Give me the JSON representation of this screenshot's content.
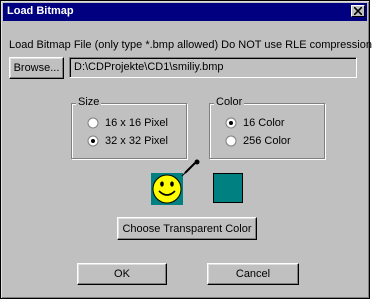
{
  "window": {
    "title": "Load Bitmap",
    "close_icon": "close-icon"
  },
  "instructions": "Load Bitmap File (only type *.bmp allowed) Do NOT use RLE compression !",
  "browse": {
    "label": "Browse...",
    "path_value": "D:\\CDProjekte\\CD1\\smiliy.bmp"
  },
  "size_group": {
    "label": "Size",
    "options": [
      {
        "label": "16 x 16 Pixel",
        "selected": false
      },
      {
        "label": "32 x 32 Pixel",
        "selected": true
      }
    ]
  },
  "color_group": {
    "label": "Color",
    "options": [
      {
        "label": "16 Color",
        "selected": true
      },
      {
        "label": "256 Color",
        "selected": false
      }
    ]
  },
  "preview": {
    "transparent_color": "#008080",
    "smiley_color": "#ffff00",
    "icon": "smiley-preview",
    "picker_icon": "eyedropper-icon"
  },
  "buttons": {
    "transparent": "Choose Transparent Color",
    "ok": "OK",
    "cancel": "Cancel"
  }
}
